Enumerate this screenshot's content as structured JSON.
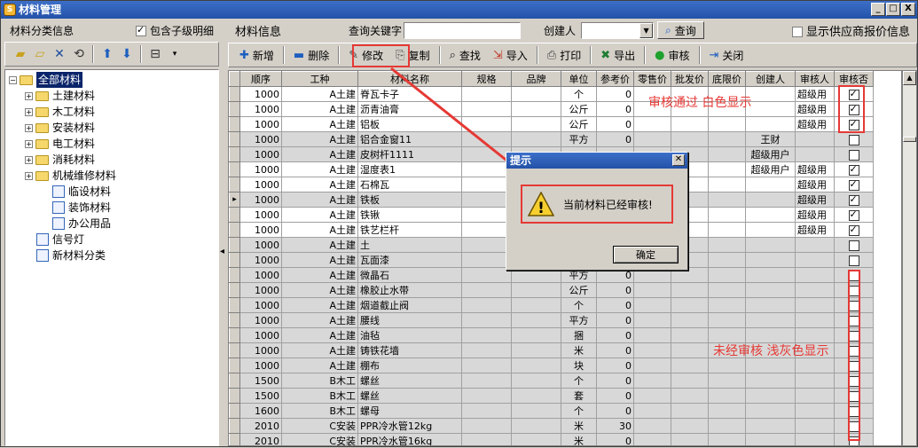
{
  "window": {
    "title": "材料管理",
    "buttons": [
      "_",
      "□",
      "X"
    ]
  },
  "left": {
    "title": "材料分类信息",
    "include_children_label": "包含子级明细",
    "include_children_checked": true,
    "tree": [
      {
        "label": "全部材料",
        "level": 0,
        "expand": "minus",
        "type": "folder",
        "selected": true
      },
      {
        "label": "土建材料",
        "level": 1,
        "expand": "plus",
        "type": "folder"
      },
      {
        "label": "木工材料",
        "level": 1,
        "expand": "plus",
        "type": "folder"
      },
      {
        "label": "安装材料",
        "level": 1,
        "expand": "plus",
        "type": "folder"
      },
      {
        "label": "电工材料",
        "level": 1,
        "expand": "plus",
        "type": "folder"
      },
      {
        "label": "消耗材料",
        "level": 1,
        "expand": "plus",
        "type": "folder"
      },
      {
        "label": "机械维修材料",
        "level": 1,
        "expand": "plus",
        "type": "folder"
      },
      {
        "label": "临设材料",
        "level": 2,
        "expand": "",
        "type": "doc"
      },
      {
        "label": "装饰材料",
        "level": 2,
        "expand": "",
        "type": "doc"
      },
      {
        "label": "办公用品",
        "level": 2,
        "expand": "",
        "type": "doc"
      },
      {
        "label": "信号灯",
        "level": 1,
        "expand": "",
        "type": "doc"
      },
      {
        "label": "新材料分类",
        "level": 1,
        "expand": "",
        "type": "doc"
      }
    ]
  },
  "right": {
    "title": "材料信息",
    "keyword_label": "查询关键字",
    "keyword_value": "",
    "creator_label": "创建人",
    "creator_value": "",
    "search_label": "查询",
    "show_supplier_label": "显示供应商报价信息",
    "show_supplier_checked": false
  },
  "toolbar": [
    {
      "label": "新增",
      "icon": "plus-icon",
      "glyph": "✚",
      "color": "#1d5fbf"
    },
    {
      "label": "删除",
      "icon": "minus-icon",
      "glyph": "▬",
      "color": "#1d5fbf"
    },
    {
      "label": "修改",
      "icon": "edit-icon",
      "glyph": "✎",
      "color": "#444"
    },
    {
      "label": "复制",
      "icon": "copy-icon",
      "glyph": "⎘",
      "color": "#444"
    },
    {
      "label": "查找",
      "icon": "binoculars-icon",
      "glyph": "⌕",
      "color": "#222"
    },
    {
      "label": "导入",
      "icon": "import-icon",
      "glyph": "⇲",
      "color": "#c0392b"
    },
    {
      "label": "打印",
      "icon": "printer-icon",
      "glyph": "⎙",
      "color": "#444"
    },
    {
      "label": "导出",
      "icon": "excel-icon",
      "glyph": "✖",
      "color": "#1e7d32"
    },
    {
      "label": "审核",
      "icon": "audit-icon",
      "glyph": "●",
      "color": "#1fa12e"
    },
    {
      "label": "关闭",
      "icon": "close-door-icon",
      "glyph": "⇥",
      "color": "#1d5fbf"
    }
  ],
  "columns": [
    "顺序",
    "工种",
    "材料名称",
    "规格",
    "品牌",
    "单位",
    "参考价",
    "零售价",
    "批发价",
    "底限价",
    "创建人",
    "审核人",
    "审核否"
  ],
  "rows": [
    {
      "seq": "1000",
      "trade": "A土建",
      "name": "脊瓦卡子",
      "unit": "个",
      "price": "0",
      "creator": "",
      "auditor": "超级用",
      "audited": true
    },
    {
      "seq": "1000",
      "trade": "A土建",
      "name": "沥青油膏",
      "unit": "公斤",
      "price": "0",
      "creator": "",
      "auditor": "超级用",
      "audited": true
    },
    {
      "seq": "1000",
      "trade": "A土建",
      "name": "铝板",
      "unit": "公斤",
      "price": "0",
      "creator": "",
      "auditor": "超级用",
      "audited": true
    },
    {
      "seq": "1000",
      "trade": "A土建",
      "name": "铝合金窗11",
      "unit": "平方",
      "price": "0",
      "creator": "王财",
      "auditor": "",
      "audited": false
    },
    {
      "seq": "1000",
      "trade": "A土建",
      "name": "皮树杆1111",
      "unit": "",
      "price": "",
      "creator": "超级用户",
      "auditor": "",
      "audited": false
    },
    {
      "seq": "1000",
      "trade": "A土建",
      "name": "湿度表1",
      "unit": "",
      "price": "",
      "creator": "超级用户",
      "auditor": "超级用",
      "audited": true
    },
    {
      "seq": "1000",
      "trade": "A土建",
      "name": "石棉瓦",
      "unit": "",
      "price": "",
      "creator": "",
      "auditor": "超级用",
      "audited": true
    },
    {
      "seq": "1000",
      "trade": "A土建",
      "name": "铁板",
      "unit": "",
      "price": "",
      "creator": "",
      "auditor": "超级用",
      "audited": true,
      "current": true
    },
    {
      "seq": "1000",
      "trade": "A土建",
      "name": "铁锹",
      "unit": "",
      "price": "",
      "creator": "",
      "auditor": "超级用",
      "audited": true
    },
    {
      "seq": "1000",
      "trade": "A土建",
      "name": "铁艺栏杆",
      "unit": "",
      "price": "",
      "creator": "",
      "auditor": "超级用",
      "audited": true
    },
    {
      "seq": "1000",
      "trade": "A土建",
      "name": "土",
      "unit": "",
      "price": "",
      "creator": "",
      "auditor": "",
      "audited": false
    },
    {
      "seq": "1000",
      "trade": "A土建",
      "name": "瓦面漆",
      "unit": "",
      "price": "",
      "creator": "",
      "auditor": "",
      "audited": false
    },
    {
      "seq": "1000",
      "trade": "A土建",
      "name": "微晶石",
      "unit": "平方",
      "price": "0",
      "creator": "",
      "auditor": "",
      "audited": false
    },
    {
      "seq": "1000",
      "trade": "A土建",
      "name": "橡胶止水带",
      "unit": "公斤",
      "price": "0",
      "creator": "",
      "auditor": "",
      "audited": false
    },
    {
      "seq": "1000",
      "trade": "A土建",
      "name": "烟道截止阀",
      "unit": "个",
      "price": "0",
      "creator": "",
      "auditor": "",
      "audited": false
    },
    {
      "seq": "1000",
      "trade": "A土建",
      "name": "腰线",
      "unit": "平方",
      "price": "0",
      "creator": "",
      "auditor": "",
      "audited": false
    },
    {
      "seq": "1000",
      "trade": "A土建",
      "name": "油毡",
      "unit": "捆",
      "price": "0",
      "creator": "",
      "auditor": "",
      "audited": false
    },
    {
      "seq": "1000",
      "trade": "A土建",
      "name": "铸铁花墙",
      "unit": "米",
      "price": "0",
      "creator": "",
      "auditor": "",
      "audited": false
    },
    {
      "seq": "1000",
      "trade": "A土建",
      "name": "棚布",
      "unit": "块",
      "price": "0",
      "creator": "",
      "auditor": "",
      "audited": false
    },
    {
      "seq": "1500",
      "trade": "B木工",
      "name": "螺丝",
      "unit": "个",
      "price": "0",
      "creator": "",
      "auditor": "",
      "audited": false
    },
    {
      "seq": "1500",
      "trade": "B木工",
      "name": "螺丝",
      "unit": "套",
      "price": "0",
      "creator": "",
      "auditor": "",
      "audited": false
    },
    {
      "seq": "1600",
      "trade": "B木工",
      "name": "螺母",
      "unit": "个",
      "price": "0",
      "creator": "",
      "auditor": "",
      "audited": false
    },
    {
      "seq": "2010",
      "trade": "C安装",
      "name": "PPR冷水管12kg",
      "unit": "米",
      "price": "30",
      "creator": "",
      "auditor": "",
      "audited": false
    },
    {
      "seq": "2010",
      "trade": "C安装",
      "name": "PPR冷水管16kg",
      "unit": "米",
      "price": "0",
      "creator": "",
      "auditor": "",
      "audited": false
    }
  ],
  "annotations": {
    "approved_note": "审核通过 白色显示",
    "unapproved_note": "未经审核 浅灰色显示",
    "color": "#e53935"
  },
  "dialog": {
    "title": "提示",
    "message": "当前材料已经审核!",
    "ok_label": "确定",
    "icon": "warning-icon"
  }
}
